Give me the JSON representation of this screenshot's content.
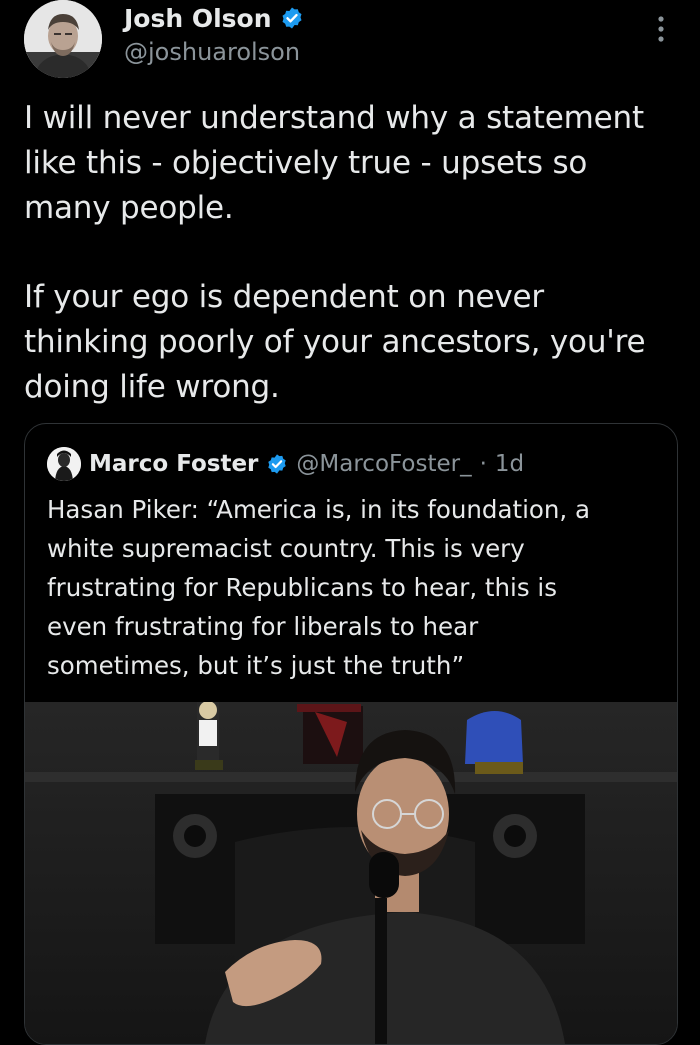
{
  "author": {
    "display_name": "Josh Olson",
    "handle": "@joshuarolson",
    "verified": true,
    "avatar_icon": "user-avatar"
  },
  "tweet": {
    "lines_para1": [
      "I will never understand why a statement",
      "like this - objectively true - upsets so",
      "many people."
    ],
    "lines_para2": [
      "If your ego is dependent on never",
      "thinking poorly of your ancestors, you're",
      "doing life wrong."
    ]
  },
  "quoted_tweet": {
    "display_name": "Marco Foster",
    "handle": "@MarcoFoster_",
    "separator": "·",
    "time": "1d",
    "verified": true,
    "lines": [
      "Hasan Piker: “America is, in its foundation, a",
      "white supremacist country. This is very",
      "frustrating for Republicans to hear, this is",
      "even frustrating for liberals to hear",
      "sometimes, but it’s just the truth”"
    ],
    "media_icon": "video-thumbnail"
  },
  "colors": {
    "background": "#000000",
    "text_primary": "#e7e9ea",
    "text_secondary": "#8b949a",
    "verified_blue": "#1d9bf0",
    "border": "#2f3336"
  }
}
